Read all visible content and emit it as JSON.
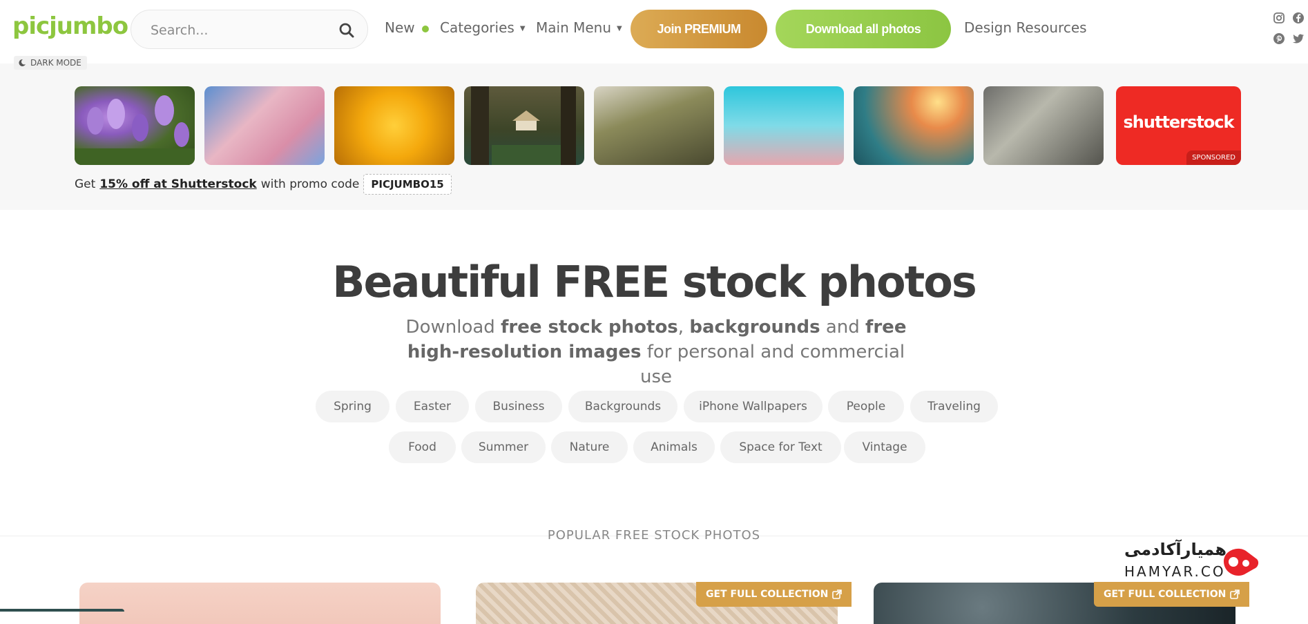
{
  "header": {
    "logo": "picjumbo",
    "search_placeholder": "Search...",
    "nav": {
      "new_label": "New",
      "categories_label": "Categories",
      "main_menu_label": "Main Menu",
      "join_premium": "Join PREMIUM",
      "download_all": "Download all photos",
      "design_resources": "Design Resources"
    },
    "dark_mode": "DARK MODE",
    "social": [
      "instagram-icon",
      "facebook-icon",
      "pinterest-icon",
      "twitter-icon"
    ]
  },
  "sponsored": {
    "thumbnails": [
      "purple crocus flowers",
      "pink blossom branches",
      "yellow flowers",
      "birdhouse in forest",
      "tree buds",
      "pink flowers on blue sky",
      "blossom at sunset",
      "white blossom"
    ],
    "shutterstock_logo": "shutterstock",
    "sponsored_label": "SPONSORED",
    "promo_prefix": "Get",
    "promo_link": "15% off at Shutterstock",
    "promo_middle": "with promo code",
    "promo_code": "PICJUMBO15"
  },
  "hero": {
    "title": "Beautiful FREE stock photos",
    "sub_1": "Download",
    "sub_b1": "free stock photos",
    "sub_2": ",",
    "sub_b2": "backgrounds",
    "sub_3": "and",
    "sub_b3": "free high-resolution images",
    "sub_4": "for personal and commercial use"
  },
  "tags": {
    "row1": [
      "Spring",
      "Easter",
      "Business",
      "Backgrounds",
      "iPhone Wallpapers",
      "People",
      "Traveling"
    ],
    "row2": [
      "Food",
      "Summer",
      "Nature",
      "Animals",
      "Space for Text",
      "Vintage"
    ]
  },
  "popular": {
    "title": "POPULAR FREE STOCK PHOTOS",
    "badge": "GET FULL COLLECTION"
  },
  "watermark": {
    "fa": "همیارآکادمی",
    "en": "HAMYAR.CO"
  },
  "colors": {
    "brand_green": "#8dc63f",
    "premium_gold": "#d49a40",
    "shutterstock_red": "#ee2a24"
  }
}
